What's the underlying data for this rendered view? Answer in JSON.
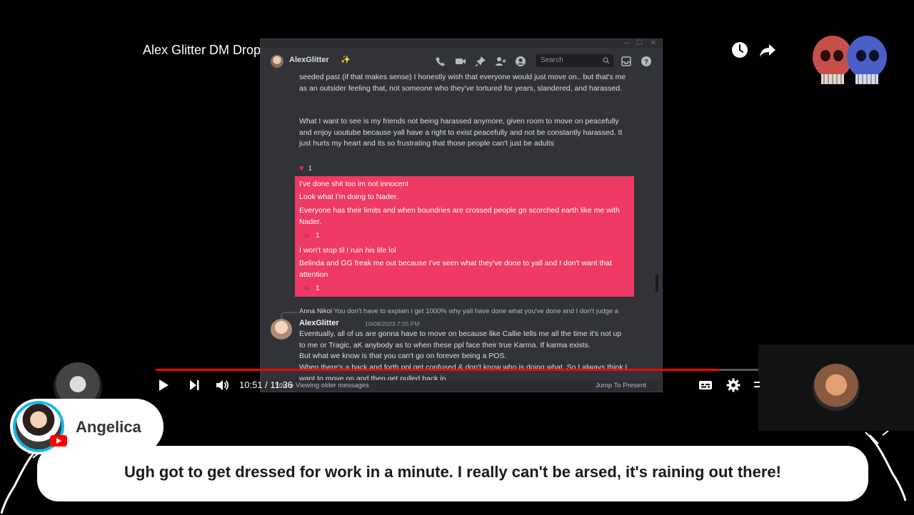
{
  "player": {
    "title": "Alex Glitter DM Drop 01",
    "time_current": "10:51",
    "time_separator": " / ",
    "time_total": "11:36",
    "progress": 0.9353
  },
  "discord": {
    "channel_name": "AlexGlitter",
    "search_placeholder": "Search",
    "messages_top": [
      "seeded past (if that makes sense) I honestly wish that everyone would just move on.. but that's me as an outsider feeling that, not someone who they've tortured for years, slandered, and harassed.",
      "What I want to see is my friends not being harassed anymore, given room to move on peacefully and enjoy uoutube because yall have a right to exist peacefully and not be constantly harassed. It just hurts my heart and its so frustrating that those people can't just be adults"
    ],
    "reaction_count_1": "1",
    "highlighted": {
      "line1": "I've done shit too im not innocent",
      "line2": "Look what I'm doing to Nader.",
      "line3": "Everyone has their limits and when boundries are crossed people go scorched earth like me with Nader.",
      "reaction_count_2": "1",
      "line4": "I won't stop til I ruin his life lol",
      "line5": "Belinda and GG freak me out because I've seen what they've done to yall and I don't want that attention",
      "reaction_count_3": "1"
    },
    "reply": {
      "author": "Anna Nikol",
      "text": "You don't have to explain i get 1000% why yall have done what you've done and I don't judge a"
    },
    "last_message": {
      "author": "AlexGlitter",
      "timestamp": "10/08/2023 7:05 PM",
      "text1": "Eventually, all of us are gonna have to move on because like Callie tells me all the time it's not up to me or Tragic, aK anybody as to when these ppl face their true Karma. If karma exists.",
      "text2": "But what we know is that you can't go on forever being a POS.",
      "text3": "When there's a back and forth ppl get confused & don't know who is doing what. So I always think I want to move on and then get pulled back in."
    },
    "older_bar": {
      "left": "You're Viewing older messages",
      "right": "Jump To Present"
    }
  },
  "chat": {
    "username": "Angelica",
    "message": "Ugh got to get dressed for work in a minute. I really can't be arsed, it's raining out there!"
  },
  "colors": {
    "highlight": "#ee3a64",
    "progress": "#ff0000",
    "discord_bg": "#313338",
    "avatar_ring": "#19b6e8"
  }
}
